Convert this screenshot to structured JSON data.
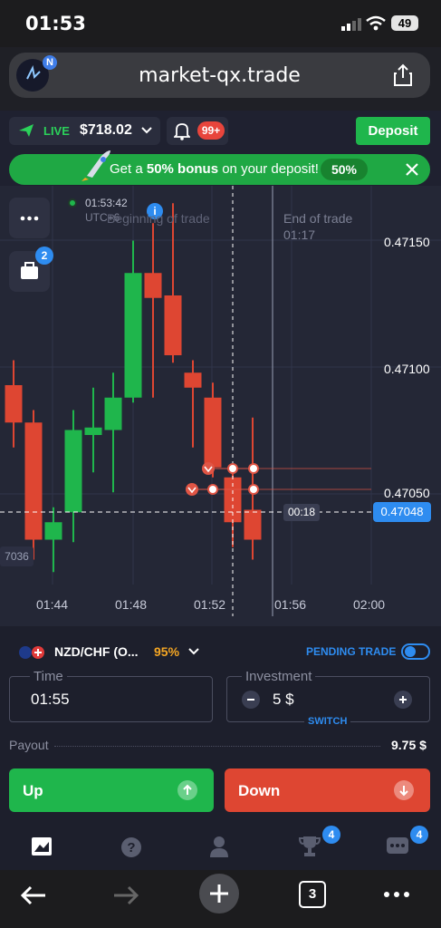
{
  "status_bar": {
    "time": "01:53",
    "battery": "49"
  },
  "browser": {
    "url": "market-qx.trade",
    "tab_count": "3"
  },
  "account": {
    "mode": "LIVE",
    "balance": "$718.02",
    "notifications": "99+",
    "deposit_label": "Deposit"
  },
  "promo": {
    "text_prefix": "Get a ",
    "text_bold": "50% bonus",
    "text_suffix": " on your deposit!",
    "percent": "50%"
  },
  "chart": {
    "current_time": "01:53:42",
    "timezone": "UTC+6",
    "beginning_label": "Beginning of trade",
    "end_label": "End of trade",
    "end_time": "01:17",
    "countdown": "00:18",
    "current_price": "0.47048",
    "left_price": "7036",
    "price_labels": [
      "0.47150",
      "0.47100",
      "0.47050"
    ],
    "time_labels": [
      "01:44",
      "01:48",
      "01:52",
      "01:56",
      "02:00"
    ],
    "portfolio_badge": "2"
  },
  "chart_data": {
    "type": "candlestick",
    "ylim": [
      0.47025,
      0.47185
    ],
    "candles": [
      {
        "o": 0.47105,
        "c": 0.4709,
        "h": 0.47115,
        "l": 0.4708
      },
      {
        "o": 0.4709,
        "c": 0.47043,
        "h": 0.47095,
        "l": 0.47035
      },
      {
        "o": 0.47043,
        "c": 0.4705,
        "h": 0.47056,
        "l": 0.4703
      },
      {
        "o": 0.47054,
        "c": 0.47087,
        "h": 0.47095,
        "l": 0.47042
      },
      {
        "o": 0.47085,
        "c": 0.47088,
        "h": 0.47104,
        "l": 0.4707
      },
      {
        "o": 0.47087,
        "c": 0.471,
        "h": 0.4711,
        "l": 0.47062
      },
      {
        "o": 0.471,
        "c": 0.4715,
        "h": 0.47163,
        "l": 0.47098
      },
      {
        "o": 0.4715,
        "c": 0.4714,
        "h": 0.4717,
        "l": 0.471
      },
      {
        "o": 0.47141,
        "c": 0.47117,
        "h": 0.47178,
        "l": 0.47114
      },
      {
        "o": 0.4711,
        "c": 0.47104,
        "h": 0.47115,
        "l": 0.4708
      },
      {
        "o": 0.471,
        "c": 0.47072,
        "h": 0.47106,
        "l": 0.47068
      },
      {
        "o": 0.47068,
        "c": 0.4705,
        "h": 0.47072,
        "l": 0.4704
      },
      {
        "o": 0.47055,
        "c": 0.47043,
        "h": 0.47092,
        "l": 0.47035
      }
    ]
  },
  "trade_panel": {
    "asset": "NZD/CHF (O...",
    "payout_percent": "95%",
    "pending_label": "PENDING TRADE",
    "time_label": "Time",
    "time_value": "01:55",
    "investment_label": "Investment",
    "investment_value": "5 $",
    "switch_label": "SWITCH",
    "payout_label": "Payout",
    "payout_value": "9.75 $",
    "up_label": "Up",
    "down_label": "Down"
  },
  "bottom_nav": {
    "trophy_badge": "4",
    "chat_badge": "4"
  },
  "colors": {
    "up": "#1fb64c",
    "down": "#de4632",
    "accent": "#2e8cf0",
    "bonus": "#1fa844"
  }
}
